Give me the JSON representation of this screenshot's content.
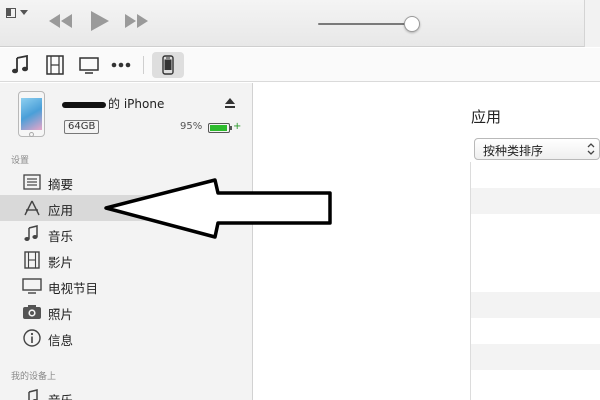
{
  "toolbar": {
    "menu_icon": "window-menu-icon",
    "controls": [
      "rewind-icon",
      "play-icon",
      "fast-forward-icon"
    ],
    "volume_level": 0.92
  },
  "media_kinds": [
    "music-icon",
    "film-icon",
    "tv-icon",
    "more-icon"
  ],
  "device_button_icon": "iphone-icon",
  "device": {
    "name_suffix": "的 iPhone",
    "capacity": "64GB",
    "battery_percent": "95%",
    "battery_level": 0.95,
    "charging_glyph": "+",
    "eject_icon": "eject-icon"
  },
  "sidebar": {
    "settings_heading": "设置",
    "settings_items": [
      {
        "label": "摘要",
        "icon": "summary-list-icon"
      },
      {
        "label": "应用",
        "icon": "app-store-icon",
        "selected": true
      },
      {
        "label": "音乐",
        "icon": "music-note-icon"
      },
      {
        "label": "影片",
        "icon": "film-icon"
      },
      {
        "label": "电视节目",
        "icon": "tv-icon"
      },
      {
        "label": "照片",
        "icon": "camera-icon"
      },
      {
        "label": "信息",
        "icon": "info-icon"
      }
    ],
    "on_device_heading": "我的设备上",
    "on_device_items": [
      {
        "label": "音乐",
        "icon": "music-note-icon"
      }
    ]
  },
  "main": {
    "title": "应用",
    "sort_select": {
      "selected": "按种类排序",
      "icon": "up-down-arrows-icon"
    }
  },
  "annotation": {
    "icon": "pointing-arrow-icon"
  },
  "colors": {
    "battery_green": "#2dbb2d",
    "selected_row": "#d9d9d9",
    "sidebar_bg": "#f3f3f3"
  }
}
